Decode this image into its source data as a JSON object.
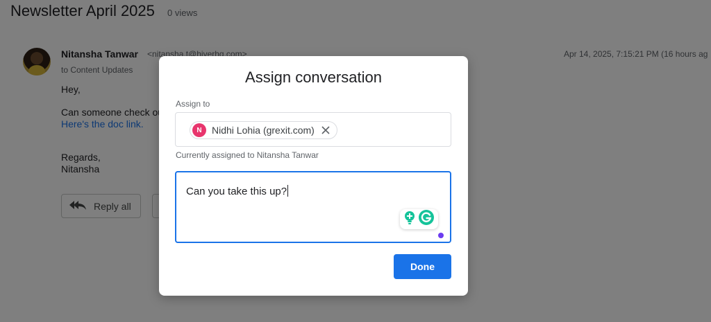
{
  "email": {
    "subject": "Newsletter April 2025",
    "views": "0 views",
    "sender_name": "Nitansha Tanwar",
    "sender_email": "<nitansha.t@hiverhq.com>",
    "date": "Apr 14, 2025, 7:15:21 PM (16 hours ag",
    "recipient": "to Content Updates",
    "greeting": "Hey,",
    "body_line": "Can someone check ou",
    "link_text": "Here's the doc link.",
    "signoff": "Regards,",
    "signature": "Nitansha",
    "reply_all_label": "Reply all"
  },
  "modal": {
    "title": "Assign conversation",
    "assign_label": "Assign to",
    "assignee": {
      "initial": "N",
      "name": "Nidhi Lohia (grexit.com)",
      "avatar_color": "#e8356d"
    },
    "currently_assigned": "Currently assigned to Nitansha Tanwar",
    "note_text": "Can you take this up?",
    "done_label": "Done"
  },
  "icons": [
    "reply-all-icon",
    "close-icon",
    "grammarly-bulb-icon",
    "grammarly-logo-icon"
  ],
  "colors": {
    "accent": "#1a73e8",
    "grammarly": "#15c39a",
    "overlay": "rgba(0,0,0,0.5)"
  }
}
